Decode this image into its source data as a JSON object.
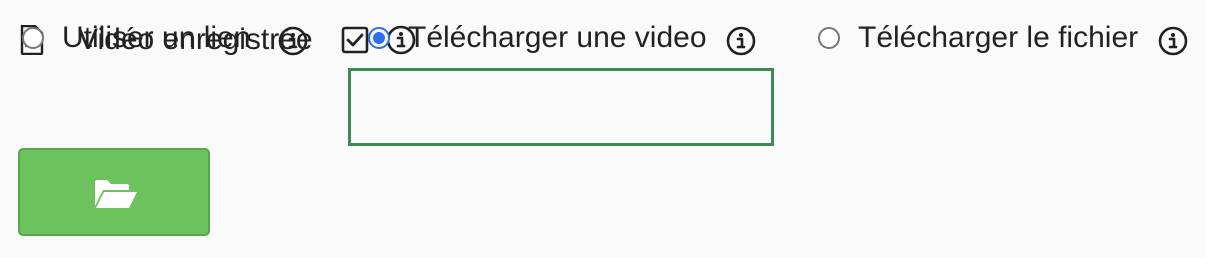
{
  "field": {
    "title": "Vidéo enregistrée",
    "checked": true,
    "icons": {
      "file": "file-video-icon",
      "check": "checkbox-checked-icon",
      "info": "info-circle-icon"
    }
  },
  "source_options": {
    "selected": "upload_video",
    "items": [
      {
        "id": "use_link",
        "label": "Utiliser un lien",
        "checked": false
      },
      {
        "id": "upload_video",
        "label": "Télécharger une video",
        "checked": true
      },
      {
        "id": "upload_file",
        "label": "Télécharger le fichier",
        "checked": false
      }
    ]
  },
  "upload_button": {
    "icon": "folder-open-icon",
    "color": "#6cc25c"
  },
  "colors": {
    "selected_border": "#3d8a55",
    "radio_accent": "#2f6fe8",
    "button_green": "#6cc25c"
  }
}
